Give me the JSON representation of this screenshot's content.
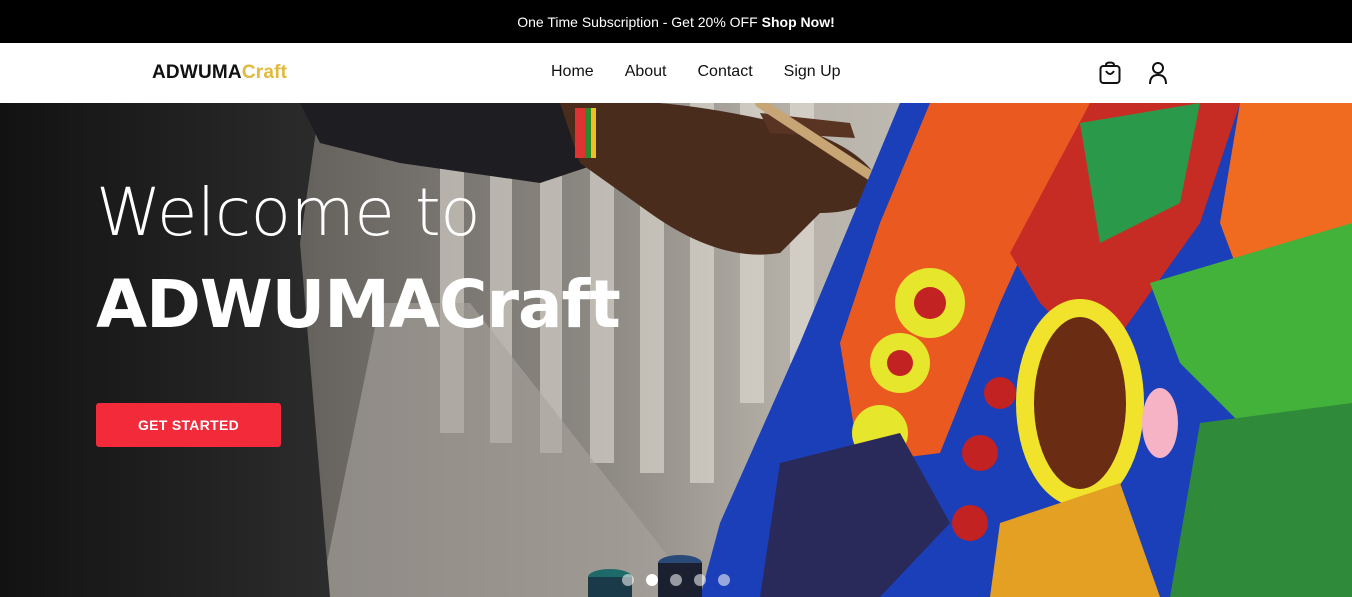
{
  "promo": {
    "text": "One Time Subscription - Get 20% OFF",
    "link": "Shop Now!"
  },
  "nav": {
    "logo_main": "ADWUMA",
    "logo_accent": "Craft",
    "links": [
      "Home",
      "About",
      "Contact",
      "Sign Up"
    ],
    "icons": [
      "shopping-bag-icon",
      "user-icon"
    ]
  },
  "hero": {
    "welcome": "Welcome to",
    "brand": "ADWUMACraft",
    "cta": "GET STARTED",
    "slides": 5,
    "active_slide": 2
  },
  "colors": {
    "accent": "#e2b93b",
    "cta": "#f22a3a",
    "topbar": "#000000"
  }
}
